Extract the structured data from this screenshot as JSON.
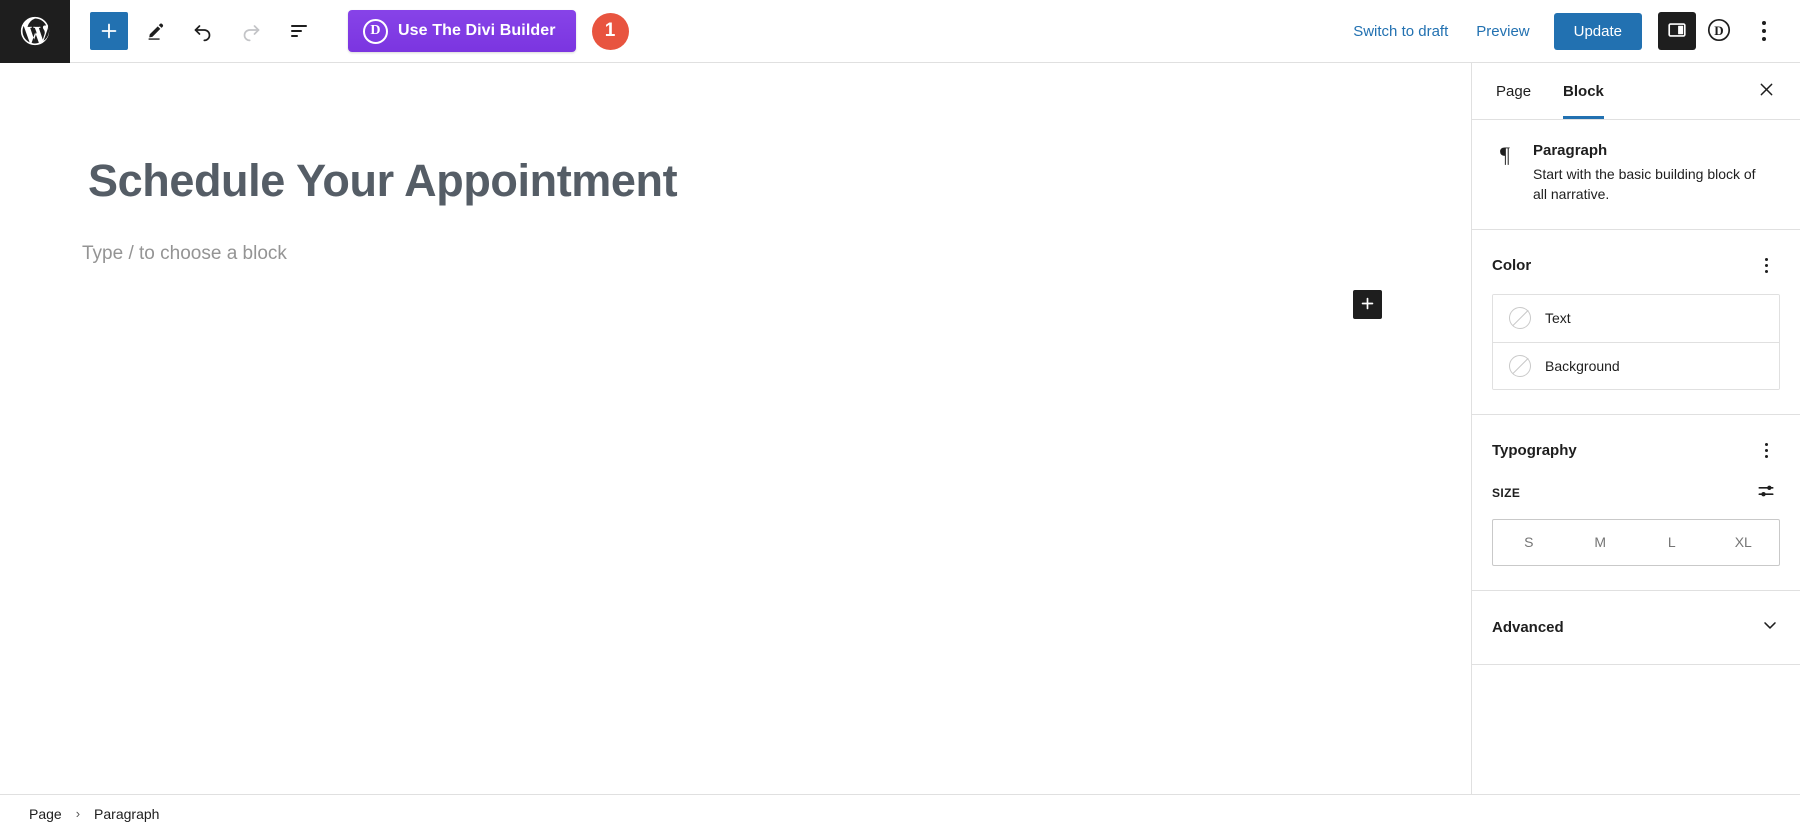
{
  "topbar": {
    "wp_logo_title": "WordPress",
    "add_block_label": "Add block",
    "tools_label": "Tools",
    "undo_label": "Undo",
    "redo_label": "Redo",
    "list_view_label": "List view",
    "divi_button_label": "Use The Divi Builder",
    "divi_mark": "D",
    "notice_count": "1",
    "switch_to_draft": "Switch to draft",
    "preview": "Preview",
    "update": "Update",
    "settings_toggle_label": "Settings",
    "divi_icon_label": "D",
    "options_label": "Options"
  },
  "editor": {
    "post_title": "Schedule Your Appointment",
    "paragraph_placeholder": "Type / to choose a block",
    "appender_label": "+"
  },
  "sidebar": {
    "tabs": [
      {
        "label": "Page",
        "active": false
      },
      {
        "label": "Block",
        "active": true
      }
    ],
    "close_label": "Close settings",
    "block_card": {
      "icon_glyph": "¶",
      "title": "Paragraph",
      "description": "Start with the basic building block of all narrative."
    },
    "color": {
      "title": "Color",
      "options_label": "Color options",
      "rows": [
        {
          "label": "Text"
        },
        {
          "label": "Background"
        }
      ]
    },
    "typography": {
      "title": "Typography",
      "options_label": "Typography options",
      "size_label": "SIZE",
      "custom_size_label": "Set custom size",
      "sizes": [
        "S",
        "M",
        "L",
        "XL"
      ],
      "selected_size": null
    },
    "advanced": {
      "title": "Advanced"
    }
  },
  "footer": {
    "breadcrumbs": [
      "Page",
      "Paragraph"
    ],
    "separator": "›"
  },
  "colors": {
    "accent_blue": "#2271b1",
    "divi_purple": "#7f3fe0",
    "notice_red": "#e8543f",
    "dark": "#1e1e1e",
    "title_gray": "#555d66",
    "placeholder_gray": "#949494",
    "border": "#e0e0e0"
  }
}
